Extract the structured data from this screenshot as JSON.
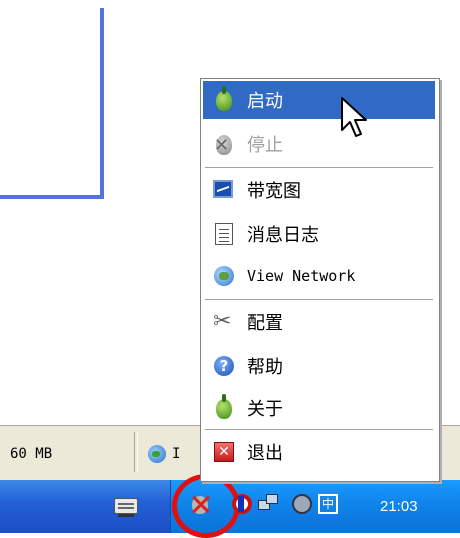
{
  "status": {
    "memory": "60 MB",
    "network_label": "I"
  },
  "menu": {
    "items": [
      {
        "label": "启动",
        "icon": "tor-onion-green-icon",
        "state": "highlighted"
      },
      {
        "label": "停止",
        "icon": "tor-onion-disabled-icon",
        "state": "disabled"
      },
      {
        "label": "带宽图",
        "icon": "bandwidth-graph-icon",
        "state": "normal"
      },
      {
        "label": "消息日志",
        "icon": "message-log-icon",
        "state": "normal"
      },
      {
        "label": "View Network",
        "icon": "globe-icon",
        "state": "normal"
      },
      {
        "label": "配置",
        "icon": "tools-icon",
        "state": "normal"
      },
      {
        "label": "帮助",
        "icon": "help-icon",
        "state": "normal"
      },
      {
        "label": "关于",
        "icon": "tor-onion-green-icon",
        "state": "normal"
      },
      {
        "label": "退出",
        "icon": "exit-icon",
        "state": "normal"
      }
    ]
  },
  "taskbar": {
    "clock": "21:03",
    "ime_glyph": "中"
  },
  "colors": {
    "highlight": "#316ac5",
    "taskbar": "#2460d8",
    "tray": "#0f82e8",
    "annotation_ring": "#e01010"
  }
}
